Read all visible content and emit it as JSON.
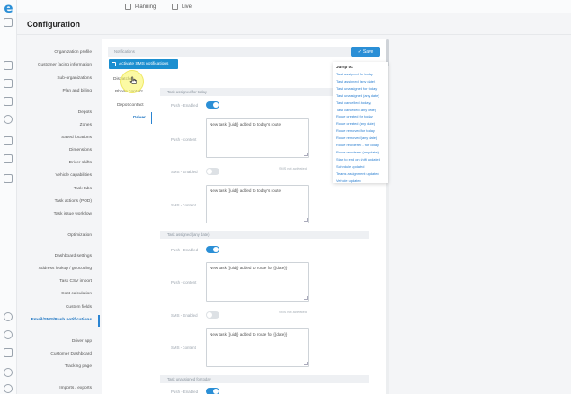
{
  "topbar": {
    "nav": [
      {
        "label": "Planning"
      },
      {
        "label": "Live"
      }
    ]
  },
  "page": {
    "title": "Configuration"
  },
  "nav_items": [
    {
      "label": "Organization profile"
    },
    {
      "label": "Customer facing information"
    },
    {
      "label": "Sub-organizations"
    },
    {
      "label": "Plan and billing"
    },
    {
      "label": "Depots"
    },
    {
      "label": "Zones"
    },
    {
      "label": "Saved locations"
    },
    {
      "label": "Dimensions"
    },
    {
      "label": "Driver shifts"
    },
    {
      "label": "Vehicle capabilities"
    },
    {
      "label": "Task tabs"
    },
    {
      "label": "Task actions (POD)"
    },
    {
      "label": "Task issue workflow"
    },
    {
      "label": "Optimization"
    },
    {
      "label": "Dashboard settings"
    },
    {
      "label": "Address lookup / geocoding"
    },
    {
      "label": "Task CSV import"
    },
    {
      "label": "Cost calculation"
    },
    {
      "label": "Custom fields"
    },
    {
      "label": "Email/SMS/Push notifications"
    },
    {
      "label": "Driver app"
    },
    {
      "label": "Customer Dashboard"
    },
    {
      "label": "Tracking page"
    },
    {
      "label": "Imports / exports"
    }
  ],
  "save_button": {
    "label": "Save",
    "icon": "check-icon"
  },
  "notifications": {
    "header": "Notifications",
    "badge": "Activate SMS notifications",
    "subtabs": [
      {
        "label": "Dispatcher"
      },
      {
        "label": "Phone contact"
      },
      {
        "label": "Depot contact"
      },
      {
        "label": "Driver"
      }
    ]
  },
  "sections": [
    {
      "title": "Task assigned for today",
      "push_enabled_label": "Push - Enabled",
      "push_content_label": "Push - content",
      "push_text": "New task {{uid}} added to today's route",
      "sms_enabled_label": "SMS - Enabled",
      "sms_note": "SMS not activated",
      "sms_content_label": "SMS - content",
      "sms_text": "New task {{uid}} added to today's route"
    },
    {
      "title": "Task assigned (any date)",
      "push_enabled_label": "Push - Enabled",
      "push_content_label": "Push - content",
      "push_text": "New task {{uid}} added to route for {{date}}",
      "sms_enabled_label": "SMS - Enabled",
      "sms_note": "SMS not activated",
      "sms_content_label": "SMS - content",
      "sms_text": "New task {{uid}} added to route for {{date}}"
    },
    {
      "title": "Task unassigned for today",
      "push_enabled_label": "Push - Enabled"
    }
  ],
  "jump": {
    "title": "Jump to:",
    "links": [
      "Task assigned for today",
      "Task assigned (any date)",
      "Task unassigned for today",
      "Task unassigned (any date)",
      "Task cancelled (today)",
      "Task cancelled (any date)",
      "Route created for today",
      "Route created (any date)",
      "Route removed for today",
      "Route removed (any date)",
      "Route reordered - for today",
      "Route reordered (any date)",
      "Start to end on shift updated",
      "Schedule updated",
      "Teams assignment updated",
      "Vehicle updated"
    ]
  },
  "colors": {
    "accent": "#2b8fd6",
    "active_text": "#1a73c2",
    "highlight": "#faf55a"
  }
}
